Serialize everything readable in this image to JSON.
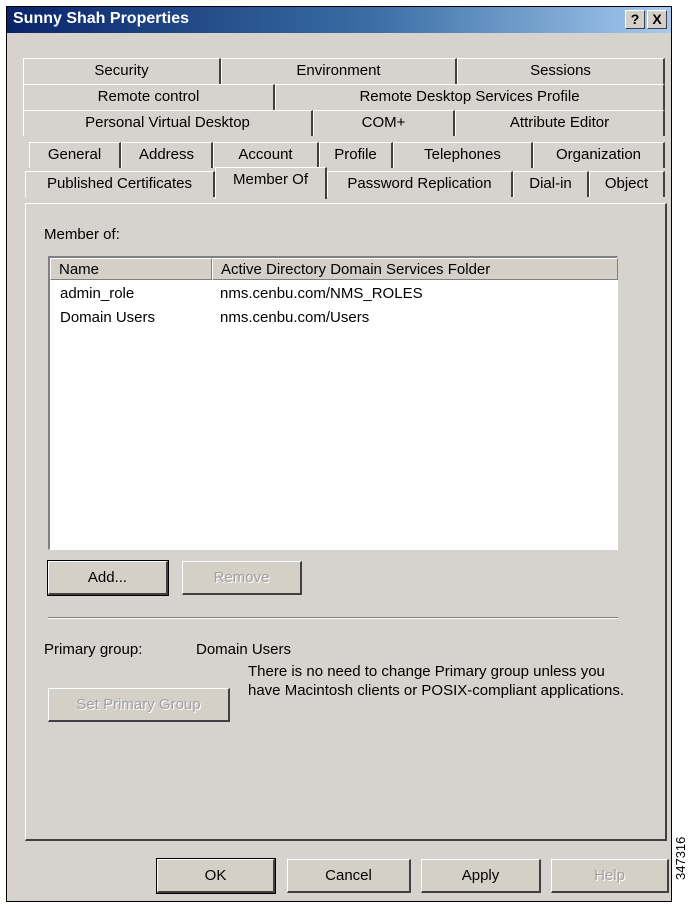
{
  "window": {
    "title": "Sunny Shah Properties",
    "help_label": "?",
    "close_label": "X"
  },
  "tabs": {
    "row1": [
      "Security",
      "Environment",
      "Sessions"
    ],
    "row2": [
      "Remote control",
      "Remote Desktop Services Profile"
    ],
    "row3": [
      "Personal Virtual Desktop",
      "COM+",
      "Attribute Editor"
    ],
    "row4": [
      "General",
      "Address",
      "Account",
      "Profile",
      "Telephones",
      "Organization"
    ],
    "row5": [
      "Published Certificates",
      "Member Of",
      "Password Replication",
      "Dial-in",
      "Object"
    ],
    "active": "Member Of"
  },
  "member_of": {
    "label": "Member of:",
    "columns": [
      "Name",
      "Active Directory Domain Services Folder"
    ],
    "rows": [
      [
        "admin_role",
        "nms.cenbu.com/NMS_ROLES"
      ],
      [
        "Domain Users",
        "nms.cenbu.com/Users"
      ]
    ],
    "add_label": "Add...",
    "remove_label": "Remove"
  },
  "primary_group": {
    "label": "Primary group:",
    "value": "Domain Users",
    "set_label": "Set Primary Group",
    "note": "There is no need to change Primary group unless you have Macintosh clients or POSIX-compliant applications."
  },
  "footer": {
    "ok_label": "OK",
    "cancel_label": "Cancel",
    "apply_label": "Apply",
    "help_label": "Help"
  },
  "figure_id": "347316"
}
